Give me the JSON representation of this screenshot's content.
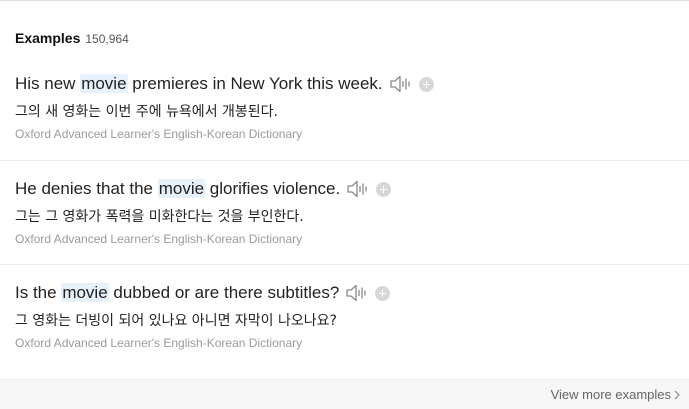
{
  "header": {
    "title": "Examples",
    "count": "150,964"
  },
  "examples": [
    {
      "before": "His new ",
      "highlight": "movie",
      "after": " premieres in New York this week.",
      "translation": "그의 새 영화는 이번 주에 뉴욕에서 개봉된다.",
      "source": "Oxford Advanced Learner's English-Korean Dictionary"
    },
    {
      "before": "He denies that the ",
      "highlight": "movie",
      "after": " glorifies violence.",
      "translation": "그는 그 영화가 폭력을 미화한다는 것을 부인한다.",
      "source": "Oxford Advanced Learner's English-Korean Dictionary"
    },
    {
      "before": "Is the ",
      "highlight": "movie",
      "after": " dubbed or are there subtitles?",
      "translation": "그 영화는 더빙이 되어 있나요 아니면 자막이 나오나요?",
      "source": "Oxford Advanced Learner's English-Korean Dictionary"
    }
  ],
  "footer": {
    "more_label": "View more examples"
  },
  "icons": {
    "speaker": "speaker-icon",
    "add": "plus-circle-icon",
    "chevron": "chevron-right-icon"
  },
  "colors": {
    "highlight_bg": "#e7f1fb",
    "source_text": "#9a9a9a",
    "footer_bg": "#f6f6f6"
  }
}
